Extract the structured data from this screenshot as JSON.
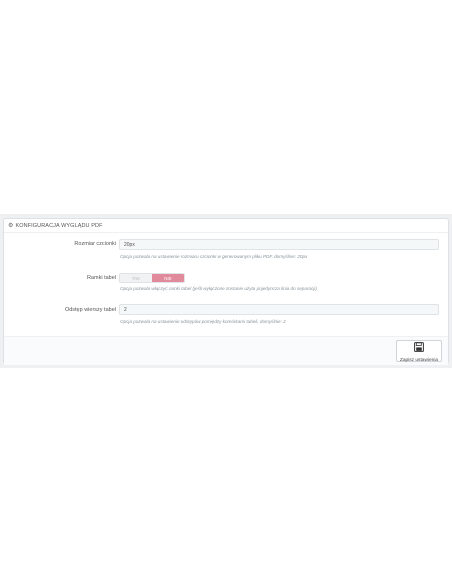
{
  "panel": {
    "title": "KONFIGURACJA WYGLĄDU PDF",
    "title_icon": "cogs-icon"
  },
  "fields": {
    "font_size": {
      "label": "Rozmiar czcionki",
      "value": "20px",
      "help": "Opcja pozwala na ustawienie rozmiaru czcionki w generowanym pliku PDF, domyślnie: 20px"
    },
    "table_borders": {
      "label": "Ramki tabel",
      "off_label": "TAK",
      "on_label": "NIE",
      "selected": "NIE",
      "help": "Opcja pozwala włączyć ramki tabel (jeśli wyłączone zostanie użyta pojedyncza linia do separacji)"
    },
    "row_spacing": {
      "label": "Odstęp wierszy tabel",
      "value": "2",
      "help": "Opcja pozwala na ustawienie odstępów pomiędzy komórkami tabeli, domyślnie: 2"
    }
  },
  "footer": {
    "save_label": "Zapisz ustawienia",
    "save_icon": "floppy-disk-icon"
  },
  "colors": {
    "toggle_active": "#e08a9b",
    "panel_background": "#ffffff",
    "page_band": "#eef0f2"
  }
}
